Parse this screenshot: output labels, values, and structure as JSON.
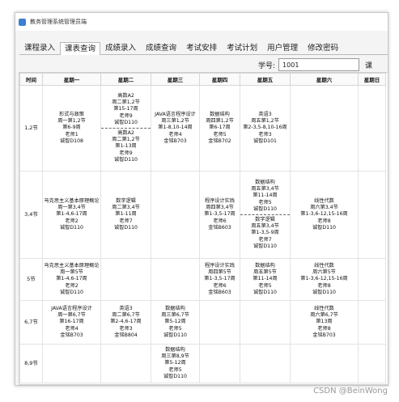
{
  "window": {
    "title": "教务管理系统管理员端"
  },
  "tabs": [
    "课程录入",
    "课表查询",
    "成绩录入",
    "成绩查询",
    "考试安排",
    "考试计划",
    "用户管理",
    "修改密码"
  ],
  "active_tab": 1,
  "student": {
    "label": "学号:",
    "value": "1001",
    "button": "课"
  },
  "headers": [
    "时间",
    "星期一",
    "星期二",
    "星期三",
    "星期四",
    "星期五",
    "星期六",
    "星期日"
  ],
  "rows": [
    {
      "slot": "1,2节",
      "cells": [
        [
          [
            "形式与政策",
            "周一第1,2节",
            "第6-9周",
            "老师1",
            "诚智D108"
          ]
        ],
        [
          [
            "高数A2",
            "周二第1,2节",
            "第15-17周",
            "老师9",
            "诚智D110"
          ],
          [
            "高数A2",
            "周二第1,2节",
            "第1-13周",
            "老师9",
            "诚智D110"
          ]
        ],
        [
          [
            "JAVA语言程序设计",
            "周三第1,2节",
            "第1-8,10-14周",
            "老师4",
            "金铭B703"
          ]
        ],
        [
          [
            "数据结构",
            "周四第1,2节",
            "第6-17周",
            "老师5",
            "金铭B702"
          ]
        ],
        [
          [
            "英语3",
            "周五第1,2节",
            "第2-3,5-8,10-16周",
            "老师3",
            "诚智D101"
          ]
        ],
        [],
        []
      ]
    },
    {
      "slot": "3,4节",
      "cells": [
        [
          [
            "马克思主义基本原理概论",
            "周一第3,4节",
            "第1-4,6-17周",
            "老师2",
            "诚智D110"
          ]
        ],
        [
          [
            "数字逻辑",
            "周二第3,4节",
            "第1-11周",
            "老师7",
            "诚智D110"
          ]
        ],
        [],
        [
          [
            "程序设计实践",
            "周四第3,4节",
            "第1-3,5-17周",
            "老师6",
            "金铭B603"
          ]
        ],
        [
          [
            "数据结构",
            "周五第3,4节",
            "第11-14周",
            "老师5",
            "诚智D110"
          ],
          [
            "数字逻辑",
            "周五第3,4节",
            "第1-3,5-9周",
            "老师7",
            "诚智D110"
          ]
        ],
        [
          [
            "线性代数",
            "周六第3,4节",
            "第1-3,6-12,15-16周",
            "老师8",
            "诚智D110"
          ]
        ],
        []
      ]
    },
    {
      "slot": "5节",
      "cells": [
        [
          [
            "马克思主义基本原理概论",
            "周一第5节",
            "第1-4,6-17周",
            "老师2",
            "诚智D110"
          ]
        ],
        [],
        [],
        [
          [
            "程序设计实践",
            "周四第5节",
            "第1-3,5-17周",
            "老师6",
            "金铭B603"
          ]
        ],
        [
          [
            "数据结构",
            "周五第5节",
            "第11-14周",
            "老师5",
            "诚智D110"
          ]
        ],
        [
          [
            "线性代数",
            "周六第5节",
            "第1-3,6-12,15-16周",
            "老师8",
            "诚智D110"
          ]
        ],
        []
      ]
    },
    {
      "slot": "6,7节",
      "cells": [
        [
          [
            "JAVA语言程序设计",
            "周一第6,7节",
            "第16-17周",
            "老师4",
            "金铭B703"
          ]
        ],
        [
          [
            "英语3",
            "周二第6,7节",
            "第2-4,6-17周",
            "老师3",
            "金铭B804"
          ]
        ],
        [
          [
            "数据结构",
            "周三第6,7节",
            "第5-12周",
            "老师5",
            "诚智D110"
          ]
        ],
        [],
        [],
        [
          [
            "线性代数",
            "周六第6,7节",
            "第13周",
            "老师8",
            "金铭B703"
          ]
        ],
        []
      ]
    },
    {
      "slot": "8,9节",
      "cells": [
        [],
        [],
        [
          [
            "数据结构",
            "周三第8,9节",
            "第5-12周",
            "老师5",
            "诚智D110"
          ]
        ],
        [],
        [],
        [],
        []
      ]
    }
  ],
  "watermark": "CSDN @BeinWong"
}
